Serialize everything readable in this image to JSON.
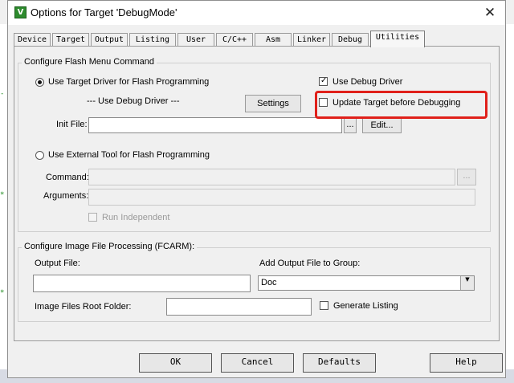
{
  "window": {
    "app_icon_text": "V",
    "title": "Options for Target 'DebugMode'",
    "close_glyph": "✕"
  },
  "tabs": [
    {
      "label": "Device"
    },
    {
      "label": "Target"
    },
    {
      "label": "Output"
    },
    {
      "label": "Listing"
    },
    {
      "label": "User"
    },
    {
      "label": "C/C++"
    },
    {
      "label": "Asm"
    },
    {
      "label": "Linker"
    },
    {
      "label": "Debug"
    },
    {
      "label": "Utilities"
    }
  ],
  "active_tab": "Utilities",
  "flash": {
    "group_title": "Configure Flash Menu Command",
    "use_target_driver_label": "Use Target Driver for Flash Programming",
    "use_target_driver_selected": true,
    "use_debug_driver_label": "Use Debug Driver",
    "use_debug_driver_checked": true,
    "driver_display": "--- Use Debug Driver ---",
    "settings_label": "Settings",
    "update_target_label": "Update Target before Debugging",
    "update_target_checked": false,
    "init_file_label": "Init File:",
    "init_file_value": "",
    "browse_label": "...",
    "edit_label": "Edit...",
    "use_external_tool_label": "Use External Tool for Flash Programming",
    "use_external_tool_selected": false,
    "command_label": "Command:",
    "command_value": "",
    "arguments_label": "Arguments:",
    "arguments_value": "",
    "run_independent_label": "Run Independent",
    "run_independent_checked": false
  },
  "image": {
    "group_title": "Configure Image File Processing (FCARM):",
    "output_file_label": "Output File:",
    "output_file_value": "",
    "add_output_label": "Add Output File  to Group:",
    "group_select_value": "Doc",
    "root_folder_label": "Image Files Root Folder:",
    "root_folder_value": "",
    "generate_listing_label": "Generate Listing",
    "generate_listing_checked": false
  },
  "buttons": {
    "ok": "OK",
    "cancel": "Cancel",
    "defaults": "Defaults",
    "help": "Help"
  },
  "colors": {
    "highlight": "#e0201a",
    "app_icon": "#2e8b2e"
  }
}
